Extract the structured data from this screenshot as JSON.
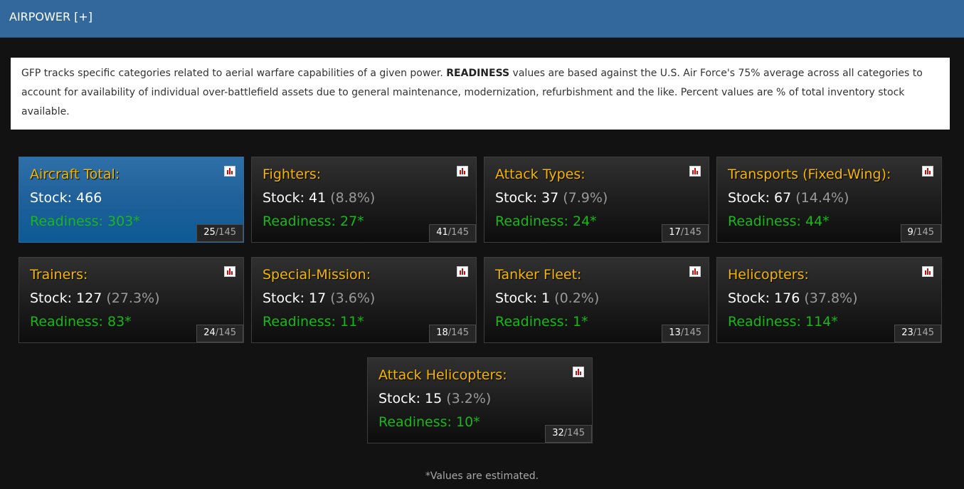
{
  "header": {
    "title": "AIRPOWER [+]"
  },
  "intro": {
    "text_before": "GFP tracks specific categories related to aerial warfare capabilities of a given power. ",
    "bold": "READINESS",
    "text_after": " values are based against the U.S. Air Force's 75% average across all categories to account for availability of individual over-battlefield assets due to general maintenance, modernization, refurbishment and the like. Percent values are % of total inventory stock available."
  },
  "cards": [
    {
      "title": "Aircraft Total:",
      "stock": "Stock: 466",
      "percent": "",
      "readiness": "Readiness: 303*",
      "rank": "25",
      "rank_total": "/145"
    },
    {
      "title": "Fighters:",
      "stock": "Stock: 41",
      "percent": "(8.8%)",
      "readiness": "Readiness: 27*",
      "rank": "41",
      "rank_total": "/145"
    },
    {
      "title": "Attack Types:",
      "stock": "Stock: 37",
      "percent": "(7.9%)",
      "readiness": "Readiness: 24*",
      "rank": "17",
      "rank_total": "/145"
    },
    {
      "title": "Transports (Fixed-Wing):",
      "stock": "Stock: 67",
      "percent": "(14.4%)",
      "readiness": "Readiness: 44*",
      "rank": "9",
      "rank_total": "/145"
    },
    {
      "title": "Trainers:",
      "stock": "Stock: 127",
      "percent": "(27.3%)",
      "readiness": "Readiness: 83*",
      "rank": "24",
      "rank_total": "/145"
    },
    {
      "title": "Special-Mission:",
      "stock": "Stock: 17",
      "percent": "(3.6%)",
      "readiness": "Readiness: 11*",
      "rank": "18",
      "rank_total": "/145"
    },
    {
      "title": "Tanker Fleet:",
      "stock": "Stock: 1",
      "percent": "(0.2%)",
      "readiness": "Readiness: 1*",
      "rank": "13",
      "rank_total": "/145"
    },
    {
      "title": "Helicopters:",
      "stock": "Stock: 176",
      "percent": "(37.8%)",
      "readiness": "Readiness: 114*",
      "rank": "23",
      "rank_total": "/145"
    },
    {
      "title": "Attack Helicopters:",
      "stock": "Stock: 15",
      "percent": "(3.2%)",
      "readiness": "Readiness: 10*",
      "rank": "32",
      "rank_total": "/145"
    }
  ],
  "footnote": "*Values are estimated.",
  "colors": {
    "header_bg": "#33689c",
    "title_text": "#f7b500",
    "readiness_text": "#1ab61a",
    "active_card": "#1f609a",
    "chart_icon_bar": "#c41010"
  },
  "icons": {
    "card_chart": "bar-chart-icon"
  }
}
